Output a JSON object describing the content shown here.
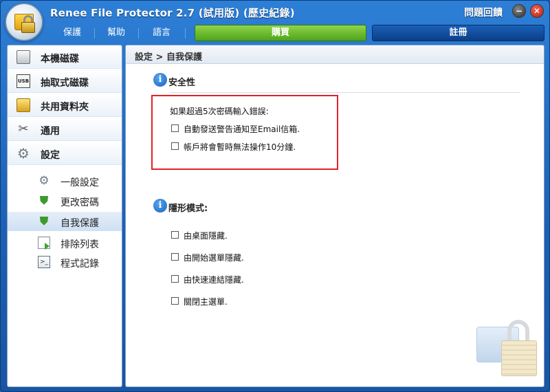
{
  "window": {
    "title": "Renee File Protector 2.7 (試用版) (歷史紀錄)",
    "feedback_label": "問題回饋",
    "minimize_label": "−",
    "close_label": "✕"
  },
  "menu": {
    "items": [
      {
        "label": "保護"
      },
      {
        "label": "幫助"
      },
      {
        "label": "語言"
      }
    ],
    "buy_label": "購買",
    "register_label": "註冊"
  },
  "sidebar": {
    "items": [
      {
        "label": "本機磁碟",
        "icon": "disk-icon"
      },
      {
        "label": "抽取式磁碟",
        "icon": "usb-icon"
      },
      {
        "label": "共用資料夾",
        "icon": "shared-folder-icon"
      },
      {
        "label": "通用",
        "icon": "tools-icon"
      },
      {
        "label": "設定",
        "icon": "gear-icon"
      }
    ],
    "sub_items": [
      {
        "label": "一般設定",
        "icon": "gear-icon",
        "active": false
      },
      {
        "label": "更改密碼",
        "icon": "shield-lock-icon",
        "active": false
      },
      {
        "label": "自我保護",
        "icon": "shield-icon",
        "active": true
      },
      {
        "label": "排除列表",
        "icon": "exclude-list-icon",
        "active": false
      },
      {
        "label": "程式記錄",
        "icon": "log-icon",
        "active": false
      }
    ],
    "usb_icon_text": "USB"
  },
  "main": {
    "breadcrumb": "設定 > 自我保護",
    "security": {
      "title": "安全性",
      "prompt": "如果超過5次密碼輸入錯誤:",
      "options": [
        {
          "label": "自動發送警告通知至Email信箱.",
          "checked": false
        },
        {
          "label": "帳戶將會暫時無法操作10分鐘.",
          "checked": false
        }
      ]
    },
    "stealth": {
      "title": "隱形模式:",
      "options": [
        {
          "label": "由桌面隱藏.",
          "checked": false
        },
        {
          "label": "由開始選單隱藏.",
          "checked": false
        },
        {
          "label": "由快速連結隱藏.",
          "checked": false
        },
        {
          "label": "關閉主選單.",
          "checked": false
        }
      ]
    },
    "info_icon_glyph": "i"
  },
  "colors": {
    "title_bar": "#1c5fb3",
    "buy_button": "#4ea41a",
    "register_button": "#0b3f86",
    "highlight_box": "#e0202a"
  }
}
